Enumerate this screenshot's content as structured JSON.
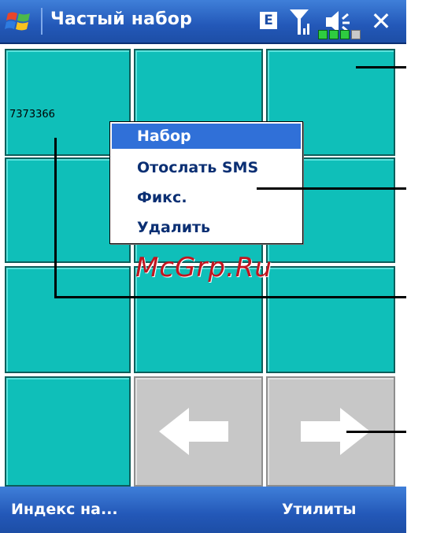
{
  "title_bar": {
    "title": "Частый набор",
    "indicator_e": "E",
    "close_label": "✕",
    "icons": [
      "windows-start-icon",
      "signal-icon",
      "volume-icon",
      "battery-icon",
      "close-icon"
    ],
    "battery_level": 0.6
  },
  "speed_dial": {
    "entries": [
      {
        "number": "7373366"
      },
      {
        "number": ""
      },
      {
        "number": ""
      },
      {
        "number": ""
      },
      {
        "number": ""
      },
      {
        "number": ""
      },
      {
        "number": ""
      },
      {
        "number": ""
      },
      {
        "number": ""
      },
      {
        "number": ""
      }
    ],
    "nav": [
      "left-arrow-icon",
      "right-arrow-icon"
    ]
  },
  "context_menu": {
    "items": [
      "Набор",
      "Отослать SMS",
      "Фикс.",
      "Удалить"
    ],
    "selected_index": 0
  },
  "watermark": "McGrp.Ru",
  "bottom_bar": {
    "left_softkey": "Индекс на...",
    "right_softkey": "Утилиты"
  },
  "colors": {
    "title_bar": "#2358b8",
    "tile": "#0fbfb9",
    "nav_tile": "#c7c7c7",
    "menu_selected": "#3070d8",
    "watermark": "#c11520"
  }
}
